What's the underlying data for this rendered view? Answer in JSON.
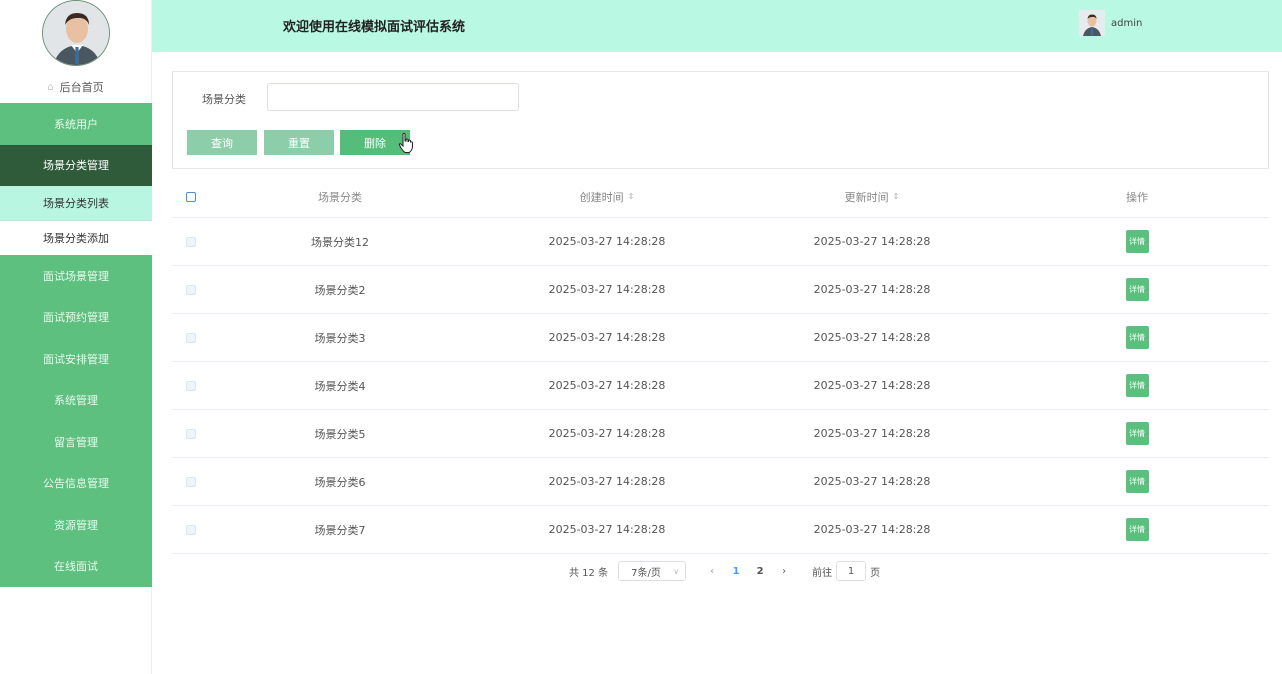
{
  "header": {
    "title": "欢迎使用在线模拟面试评估系统",
    "username": "admin"
  },
  "sidebar": {
    "home_label": "后台首页",
    "items": [
      {
        "label": "系统用户"
      },
      {
        "label": "场景分类管理"
      },
      {
        "label": "场景分类列表"
      },
      {
        "label": "场景分类添加"
      },
      {
        "label": "面试场景管理"
      },
      {
        "label": "面试预约管理"
      },
      {
        "label": "面试安排管理"
      },
      {
        "label": "系统管理"
      },
      {
        "label": "留言管理"
      },
      {
        "label": "公告信息管理"
      },
      {
        "label": "资源管理"
      },
      {
        "label": "在线面试"
      }
    ]
  },
  "search": {
    "label": "场景分类",
    "query_label": "查询",
    "reset_label": "重置",
    "delete_label": "删除"
  },
  "table": {
    "columns": {
      "name": "场景分类",
      "created": "创建时间",
      "updated": "更新时间",
      "ops": "操作"
    },
    "rows": [
      {
        "name": "场景分类12",
        "created": "2025-03-27 14:28:28",
        "updated": "2025-03-27 14:28:28",
        "action": "详情"
      },
      {
        "name": "场景分类2",
        "created": "2025-03-27 14:28:28",
        "updated": "2025-03-27 14:28:28",
        "action": "详情"
      },
      {
        "name": "场景分类3",
        "created": "2025-03-27 14:28:28",
        "updated": "2025-03-27 14:28:28",
        "action": "详情"
      },
      {
        "name": "场景分类4",
        "created": "2025-03-27 14:28:28",
        "updated": "2025-03-27 14:28:28",
        "action": "详情"
      },
      {
        "name": "场景分类5",
        "created": "2025-03-27 14:28:28",
        "updated": "2025-03-27 14:28:28",
        "action": "详情"
      },
      {
        "name": "场景分类6",
        "created": "2025-03-27 14:28:28",
        "updated": "2025-03-27 14:28:28",
        "action": "详情"
      },
      {
        "name": "场景分类7",
        "created": "2025-03-27 14:28:28",
        "updated": "2025-03-27 14:28:28",
        "action": "详情"
      }
    ]
  },
  "pagination": {
    "total": "共 12 条",
    "page_size": "7条/页",
    "pages": [
      "1",
      "2"
    ],
    "current_page": "1",
    "goto_prefix": "前往",
    "goto_value": "1",
    "goto_suffix": "页"
  },
  "colors": {
    "sidebar_green": "#5dc07f",
    "sidebar_active": "#2f5b3a",
    "header_bg": "#b9f8e3",
    "accent_blue": "#409eff"
  }
}
